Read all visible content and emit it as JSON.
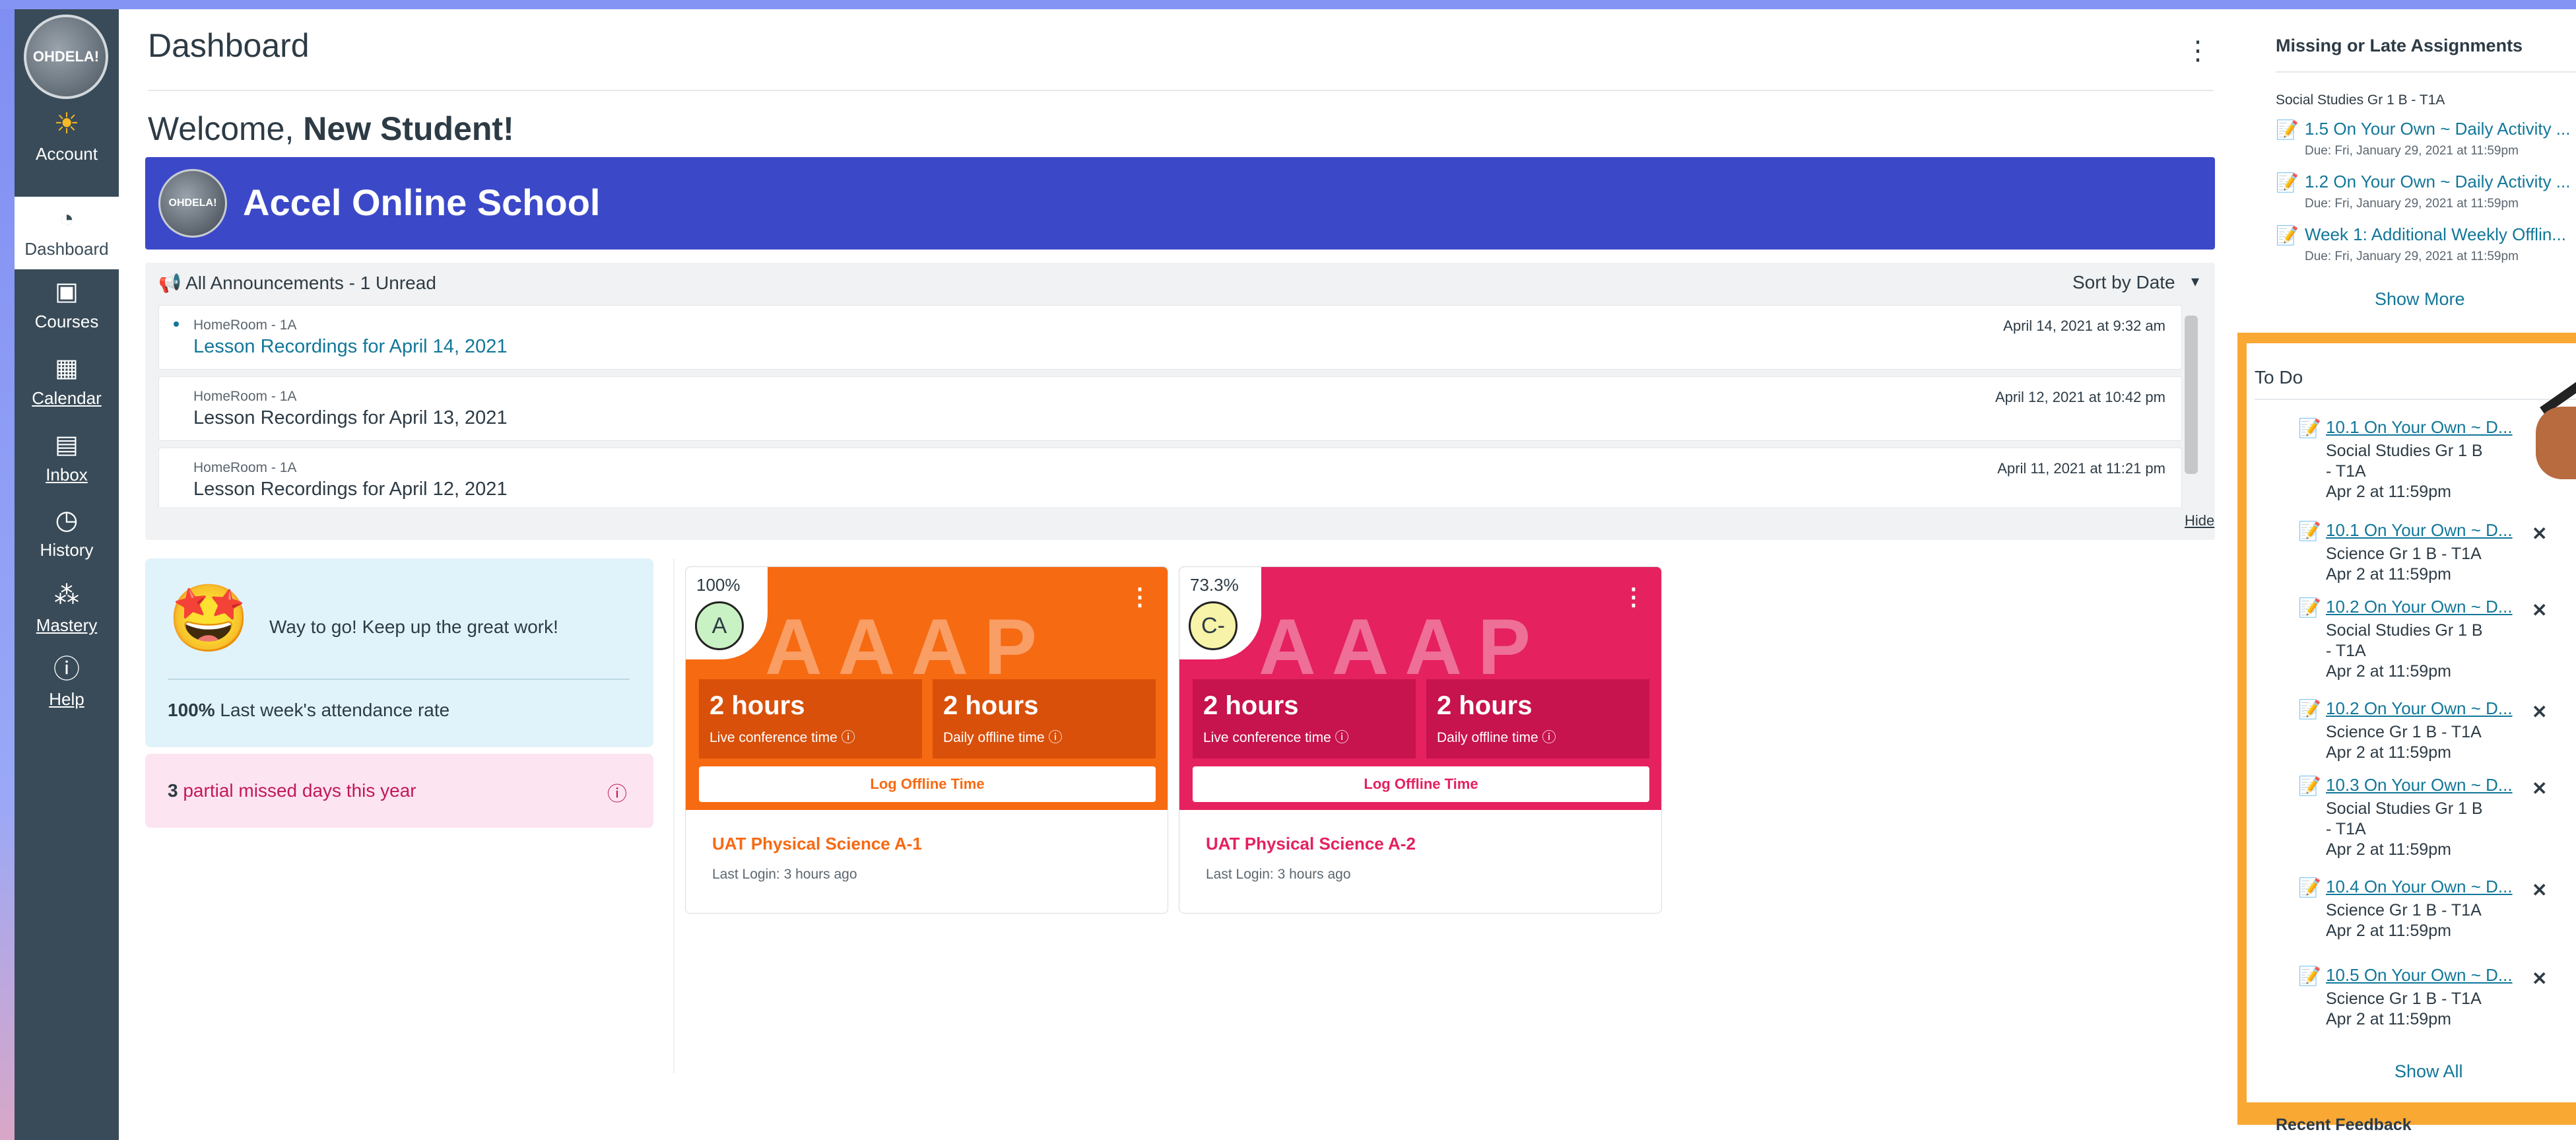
{
  "nav": {
    "logo_text": "OHDELA!",
    "items": [
      {
        "label": "Account",
        "icon": "account-sun-icon"
      },
      {
        "label": "Dashboard",
        "icon": "dashboard-icon"
      },
      {
        "label": "Courses",
        "icon": "courses-icon"
      },
      {
        "label": "Calendar",
        "icon": "calendar-icon"
      },
      {
        "label": "Inbox",
        "icon": "inbox-icon"
      },
      {
        "label": "History",
        "icon": "history-icon"
      },
      {
        "label": "Mastery",
        "icon": "mastery-icon"
      },
      {
        "label": "Help",
        "icon": "help-icon"
      }
    ]
  },
  "header": {
    "title": "Dashboard",
    "kebab": "⋮"
  },
  "welcome": {
    "prefix": "Welcome,",
    "name": "New Student!"
  },
  "banner": {
    "avatar_text": "OHDELA!",
    "school": "Accel Online School",
    "color": "#3b49c8"
  },
  "announcements": {
    "header": "All Announcements - 1 Unread",
    "sort": "Sort by Date",
    "hide": "Hide",
    "items": [
      {
        "context": "HomeRoom - 1A",
        "title": "Lesson Recordings for April 14, 2021",
        "date": "April 14, 2021 at 9:32 am",
        "unread": true
      },
      {
        "context": "HomeRoom - 1A",
        "title": "Lesson Recordings for April 13, 2021",
        "date": "April 12, 2021 at 10:42 pm",
        "unread": false
      },
      {
        "context": "HomeRoom - 1A",
        "title": "Lesson Recordings for April 12, 2021",
        "date": "April 11, 2021 at 11:21 pm",
        "unread": false
      }
    ]
  },
  "attendance": {
    "message": "Way to go! Keep up the great work!",
    "rate_value": "100%",
    "rate_label": "Last week's attendance rate",
    "missed_count": "3",
    "missed_label": "partial missed days this year"
  },
  "courses": [
    {
      "percent": "100%",
      "grade": "A",
      "grade_color": "#c9f2c4",
      "color": "#f66a12",
      "box_color": "#d9500a",
      "watermark": "AAAP",
      "live_value": "2 hours",
      "live_label": "Live conference time",
      "offline_value": "2 hours",
      "offline_label": "Daily offline time",
      "log_label": "Log Offline Time",
      "name": "UAT Physical Science A-1",
      "last_login": "Last Login: 3 hours ago"
    },
    {
      "percent": "73.3%",
      "grade": "C-",
      "grade_color": "#f7f3a8",
      "color": "#e5215f",
      "box_color": "#c7134e",
      "watermark": "AAAP",
      "live_value": "2 hours",
      "live_label": "Live conference time",
      "offline_value": "2 hours",
      "offline_label": "Daily offline time",
      "log_label": "Log Offline Time",
      "name": "UAT Physical Science A-2",
      "last_login": "Last Login: 3 hours ago"
    }
  ],
  "missing": {
    "title": "Missing or Late Assignments",
    "context": "Social Studies Gr 1 B - T1A",
    "items": [
      {
        "title": "1.5 On Your Own ~ Daily Activity ...",
        "due": "Due: Fri, January 29, 2021 at 11:59pm"
      },
      {
        "title": "1.2 On Your Own ~ Daily Activity ...",
        "due": "Due: Fri, January 29, 2021 at 11:59pm"
      },
      {
        "title": "Week 1: Additional Weekly Offlin...",
        "due": "Due: Fri, January 29, 2021 at 11:59pm"
      }
    ],
    "show_more": "Show More"
  },
  "todo": {
    "title": "To Do",
    "items": [
      {
        "title": "10.1 On Your Own ~ D...",
        "course": "Social Studies Gr 1 B - T1A",
        "due": "Apr 2 at 11:59pm",
        "x": ""
      },
      {
        "title": "10.1 On Your Own ~ D...",
        "course": "Science Gr 1 B - T1A",
        "due": "Apr 2 at 11:59pm",
        "x": "✕"
      },
      {
        "title": "10.2 On Your Own ~ D...",
        "course": "Social Studies Gr 1 B - T1A",
        "due": "Apr 2 at 11:59pm",
        "x": "✕"
      },
      {
        "title": "10.2 On Your Own ~ D...",
        "course": "Science Gr 1 B - T1A",
        "due": "Apr 2 at 11:59pm",
        "x": "✕"
      },
      {
        "title": "10.3 On Your Own ~ D...",
        "course": "Social Studies Gr 1 B - T1A",
        "due": "Apr 2 at 11:59pm",
        "x": "✕"
      },
      {
        "title": "10.4 On Your Own ~ D...",
        "course": "Science Gr 1 B - T1A",
        "due": "Apr 2 at 11:59pm",
        "x": "✕"
      },
      {
        "title": "10.5 On Your Own ~ D...",
        "course": "Science Gr 1 B - T1A",
        "due": "Apr 2 at 11:59pm",
        "x": "✕"
      }
    ],
    "show_all": "Show All"
  },
  "recent_feedback": "Recent Feedback"
}
